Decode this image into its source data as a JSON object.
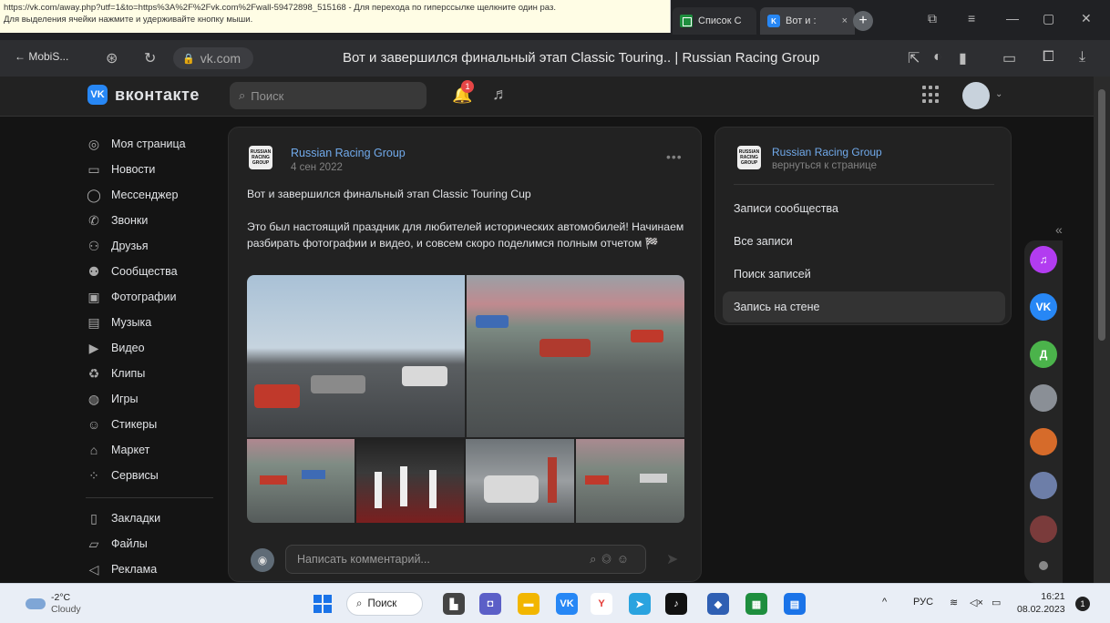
{
  "tooltip": {
    "line1": "https://vk.com/away.php?utf=1&to=https%3A%2F%2Fvk.com%2Fwall-59472898_515168 - Для перехода по гиперссылке щелкните один раз.",
    "line2": "Для выделения ячейки нажмите и удерживайте кнопку мыши."
  },
  "browser": {
    "tabs": [
      {
        "label": "Список С",
        "icon": "sheets-icon"
      },
      {
        "label": "Вот и :",
        "icon": "vk-icon",
        "close": "×"
      }
    ],
    "new_tab": "+",
    "back_label": "← MobiS...",
    "address": "vk.com",
    "page_title": "Вот и завершился финальный этап Classic Touring.. | Russian Racing Group",
    "window_controls": {
      "minimize": "—",
      "maximize": "▢",
      "close": "✕"
    }
  },
  "vk": {
    "logo_mark": "VK",
    "logo_text": "вконтакте",
    "search_placeholder": "Поиск",
    "notif_count": "1",
    "nav_items": [
      {
        "label": "Моя страница",
        "icon": "profile-icon",
        "glyph": "◎"
      },
      {
        "label": "Новости",
        "icon": "news-icon",
        "glyph": "▭"
      },
      {
        "label": "Мессенджер",
        "icon": "messenger-icon",
        "glyph": "◯"
      },
      {
        "label": "Звонки",
        "icon": "calls-icon",
        "glyph": "✆"
      },
      {
        "label": "Друзья",
        "icon": "friends-icon",
        "glyph": "⚇"
      },
      {
        "label": "Сообщества",
        "icon": "communities-icon",
        "glyph": "⚉"
      },
      {
        "label": "Фотографии",
        "icon": "photos-icon",
        "glyph": "▣"
      },
      {
        "label": "Музыка",
        "icon": "music-icon",
        "glyph": "▤"
      },
      {
        "label": "Видео",
        "icon": "video-icon",
        "glyph": "▶"
      },
      {
        "label": "Клипы",
        "icon": "clips-icon",
        "glyph": "♻"
      },
      {
        "label": "Игры",
        "icon": "games-icon",
        "glyph": "◍"
      },
      {
        "label": "Стикеры",
        "icon": "stickers-icon",
        "glyph": "☺"
      },
      {
        "label": "Маркет",
        "icon": "market-icon",
        "glyph": "⌂"
      },
      {
        "label": "Сервисы",
        "icon": "services-icon",
        "glyph": "⁘"
      }
    ],
    "nav_items_2": [
      {
        "label": "Закладки",
        "icon": "bookmarks-icon",
        "glyph": "▯"
      },
      {
        "label": "Файлы",
        "icon": "files-icon",
        "glyph": "▱"
      },
      {
        "label": "Реклама",
        "icon": "ads-icon",
        "glyph": "◁"
      }
    ]
  },
  "post": {
    "author": "Russian Racing Group",
    "date": "4 сен 2022",
    "avatar_text": "RUSSIAN RACING GROUP",
    "more": "•••",
    "paragraph1": "Вот и завершился финальный этап Classic Touring Cup",
    "paragraph2": "Это был настоящий праздник для любителей исторических автомобилей! Начинаем разбирать фотографии и видео, и совсем скоро поделимся полным отчетом 🏁",
    "comment_placeholder": "Написать комментарий..."
  },
  "side_card": {
    "name": "Russian Racing Group",
    "back": "вернуться к странице",
    "menu": [
      {
        "label": "Записи сообщества",
        "selected": false
      },
      {
        "label": "Все записи",
        "selected": false
      },
      {
        "label": "Поиск записей",
        "selected": false
      },
      {
        "label": "Запись на стене",
        "selected": true
      }
    ]
  },
  "dock": {
    "collapse": "«",
    "items": [
      {
        "name": "vk-music-dock-icon",
        "color": "#b23cf0",
        "glyph": "♫"
      },
      {
        "name": "vk-dock-icon",
        "color": "#2787f5",
        "glyph": "VK"
      },
      {
        "name": "contact-d-avatar",
        "color": "#4bb34b",
        "glyph": "Д"
      },
      {
        "name": "contact-avatar-1",
        "color": "#8a8f96",
        "glyph": ""
      },
      {
        "name": "contact-avatar-2",
        "color": "#d66b2a",
        "glyph": ""
      },
      {
        "name": "contact-avatar-3",
        "color": "#6d7ea8",
        "glyph": ""
      },
      {
        "name": "contact-avatar-4",
        "color": "#7a3b3b",
        "glyph": ""
      }
    ]
  },
  "taskbar": {
    "temperature": "-2°C",
    "condition": "Cloudy",
    "search_label": "Поиск",
    "apps": [
      {
        "name": "file-explorer-taskbar-icon",
        "color": "#444",
        "glyph": "▙"
      },
      {
        "name": "teams-taskbar-icon",
        "color": "#5b5fc7",
        "glyph": "◘"
      },
      {
        "name": "folder-taskbar-icon",
        "color": "#f2b600",
        "glyph": "▬"
      },
      {
        "name": "vk-taskbar-icon",
        "color": "#2787f5",
        "glyph": "VK"
      },
      {
        "name": "yandex-taskbar-icon",
        "color": "#ffffff",
        "glyph": "Y"
      },
      {
        "name": "telegram-taskbar-icon",
        "color": "#2aa3df",
        "glyph": "➤"
      },
      {
        "name": "tiktok-taskbar-icon",
        "color": "#111111",
        "glyph": "♪"
      },
      {
        "name": "security-taskbar-icon",
        "color": "#2f5fb3",
        "glyph": "◆"
      },
      {
        "name": "sheets-taskbar-icon",
        "color": "#1e8e3e",
        "glyph": "▦"
      },
      {
        "name": "docs-taskbar-icon",
        "color": "#1a73e8",
        "glyph": "▤"
      }
    ],
    "tray_chevron": "^",
    "language": "РУС",
    "time": "16:21",
    "date": "08.02.2023",
    "notif_count": "1"
  },
  "colors": {
    "vk_blue": "#2787f5",
    "link": "#71aaeb",
    "background": "#141414",
    "card": "#222222"
  }
}
